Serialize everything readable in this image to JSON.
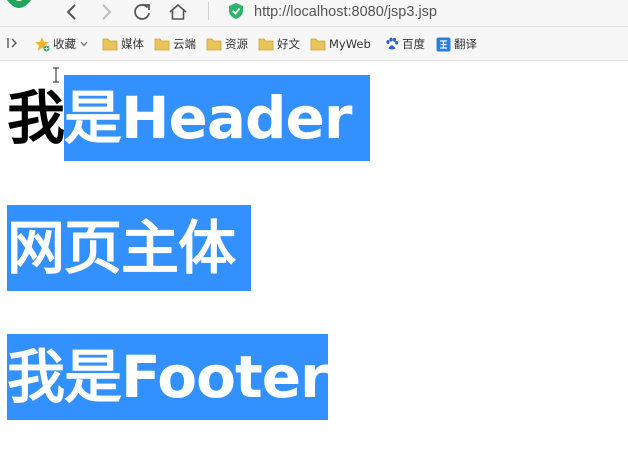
{
  "toolbar": {
    "address": "http://localhost:8080/jsp3.jsp"
  },
  "bookmarks": {
    "favorites": "收藏",
    "items": [
      "媒体",
      "云端",
      "资源",
      "好文",
      "MyWeb",
      "百度",
      "翻译"
    ]
  },
  "page": {
    "header_unselected": "我",
    "header_selected": "是Header",
    "body": "网页主体",
    "footer": "我是Footer"
  },
  "colors": {
    "selection": "#3390ff",
    "toolbar_bg": "#f7f7f7",
    "folder": "#e8c45a",
    "shield": "#2fb56b"
  }
}
